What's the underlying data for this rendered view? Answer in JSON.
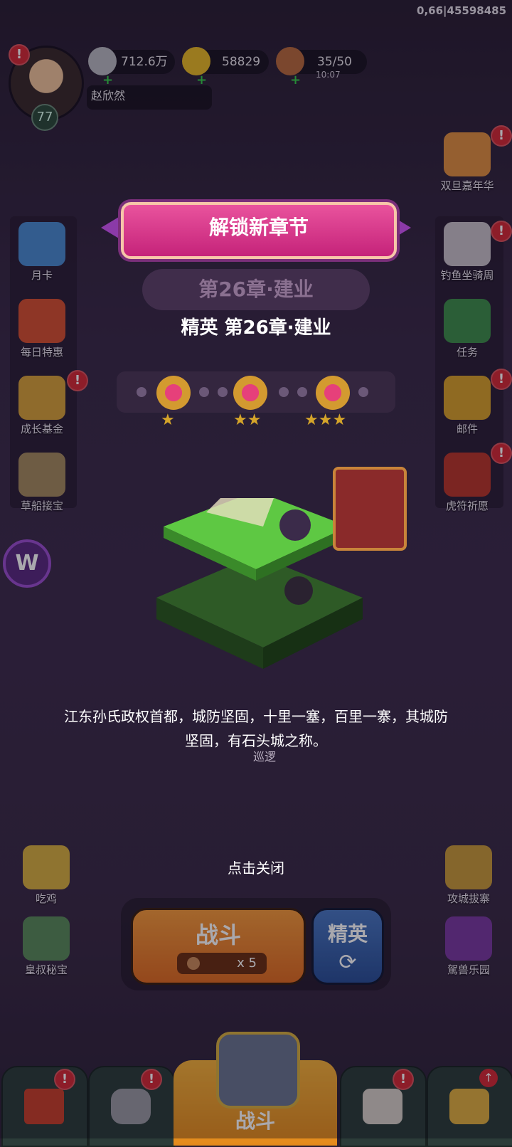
{
  "debug": "0,66|45598485",
  "player": {
    "name": "赵欣然",
    "level": "77",
    "alert": "!"
  },
  "resources": {
    "silver": "712.6万",
    "gold": "58829",
    "stamina": "35/50",
    "stamina_timer": "10:07"
  },
  "left_menu": [
    {
      "label": "月卡",
      "icon": "month-card-icon",
      "alert": false
    },
    {
      "label": "每日特惠",
      "icon": "daily-deal-icon",
      "alert": false
    },
    {
      "label": "成长基金",
      "icon": "growth-fund-icon",
      "alert": true
    },
    {
      "label": "草船接宝",
      "icon": "straw-boat-icon",
      "alert": false
    }
  ],
  "right_menu": [
    {
      "label": "双旦嘉年华",
      "icon": "carnival-icon",
      "alert": true
    },
    {
      "label": "钓鱼坐骑周",
      "icon": "fishing-mount-icon",
      "alert": true
    },
    {
      "label": "任务",
      "icon": "task-icon",
      "alert": false
    },
    {
      "label": "邮件",
      "icon": "mail-icon",
      "alert": true
    },
    {
      "label": "虎符祈愿",
      "icon": "tiger-tally-icon",
      "alert": true
    }
  ],
  "popup": {
    "banner": "解锁新章节",
    "chapter_ghost": "第26章·建业",
    "subtitle": "精英 第26章·建业",
    "description": "江东孙氏政权首都，城防坚固，十里一塞，百里一寨，其城防坚固，有石头城之称。",
    "close_hint": "点击关闭",
    "behind_label": "巡逻"
  },
  "stars_bar": {
    "medals": [
      1,
      2,
      3
    ]
  },
  "bottom_left": [
    {
      "label": "吃鸡",
      "icon": "chicken-icon"
    },
    {
      "label": "皇叔秘宝",
      "icon": "uncle-treasure-icon"
    }
  ],
  "bottom_right": [
    {
      "label": "攻城拔寨",
      "icon": "siege-icon"
    },
    {
      "label": "駕兽乐园",
      "icon": "beast-park-icon"
    }
  ],
  "battle": {
    "label": "战斗",
    "cost": "x 5",
    "elite_label": "精英",
    "refresh_icon": "⟳"
  },
  "tabs": {
    "active_label": "战斗"
  },
  "colors": {
    "banner_pink": "#e9539d",
    "battle_orange": "#f59a3a",
    "elite_blue": "#4a78c2",
    "alert_red": "#d42a35"
  }
}
